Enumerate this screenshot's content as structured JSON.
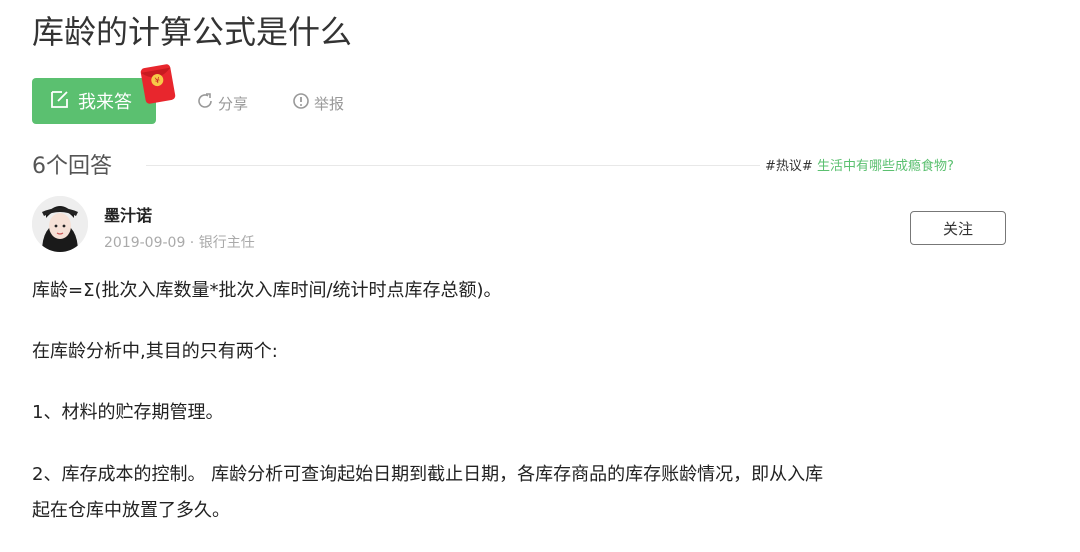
{
  "question": {
    "title": "库龄的计算公式是什么"
  },
  "actions": {
    "answer_label": "我来答",
    "share_label": "分享",
    "report_label": "举报"
  },
  "answers_header": {
    "count_label": "6个回答",
    "hot_tag": "#热议#",
    "hot_topic": "生活中有哪些成瘾食物?"
  },
  "author": {
    "name": "墨汁诺",
    "meta": "2019-09-09 · 银行主任",
    "follow_label": "关注"
  },
  "answer": {
    "paragraphs": [
      "库龄=Σ(批次入库数量*批次入库时间/统计时点库存总额)。",
      "在库龄分析中,其目的只有两个:",
      "1、材料的贮存期管理。",
      "2、库存成本的控制。 库龄分析可查询起始日期到截止日期，各库存商品的库存账龄情况，即从入库",
      "起在仓库中放置了多久。"
    ]
  },
  "colors": {
    "accent": "#5bc070",
    "muted": "#999999",
    "redpacket": "#e8262d"
  },
  "icons": {
    "answer": "edit-icon",
    "share": "share-icon",
    "report": "report-icon",
    "redpacket": "red-packet-icon"
  }
}
